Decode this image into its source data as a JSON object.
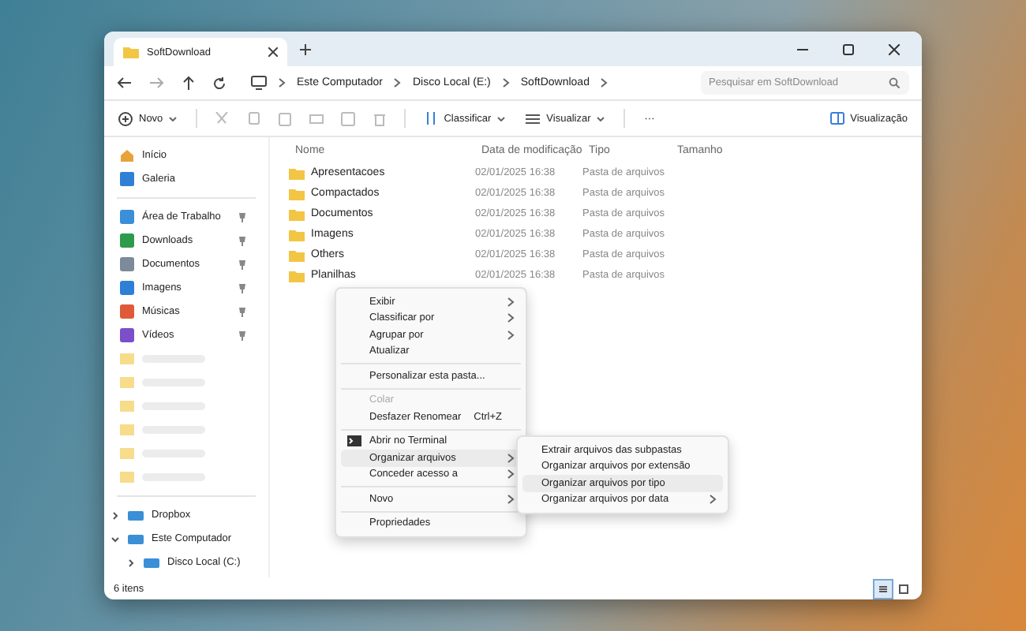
{
  "tabs": [
    {
      "title": "SoftDownload",
      "selected": true
    }
  ],
  "address": {
    "crumbs": [
      "Este Computador",
      "Disco Local (E:)",
      "SoftDownload"
    ],
    "search_placeholder": "Pesquisar em SoftDownload"
  },
  "toolbar": {
    "new": "Novo",
    "sort": "Classificar",
    "view": "Visualizar",
    "more": "···",
    "preview": "Visualização"
  },
  "sidebar": {
    "top": [
      "Início",
      "Galeria"
    ],
    "pinned": [
      {
        "label": "Área de Trabalho",
        "pinned": true
      },
      {
        "label": "Downloads",
        "pinned": true
      },
      {
        "label": "Documentos",
        "pinned": true
      },
      {
        "label": "Imagens",
        "pinned": true
      },
      {
        "label": "Músicas",
        "pinned": true
      },
      {
        "label": "Vídeos",
        "pinned": true
      }
    ],
    "tree": [
      {
        "label": "Dropbox",
        "expanded": false
      },
      {
        "label": "Este Computador",
        "expanded": true,
        "children": [
          {
            "label": "Disco Local (C:)",
            "expanded": false
          }
        ]
      }
    ]
  },
  "table": {
    "columns": [
      "Nome",
      "Data de modificação",
      "Tipo",
      "Tamanho"
    ],
    "rows": [
      {
        "name": "Apresentacoes",
        "date": "02/01/2025 16:38",
        "type": "Pasta de arquivos"
      },
      {
        "name": "Compactados",
        "date": "02/01/2025 16:38",
        "type": "Pasta de arquivos"
      },
      {
        "name": "Documentos",
        "date": "02/01/2025 16:38",
        "type": "Pasta de arquivos"
      },
      {
        "name": "Imagens",
        "date": "02/01/2025 16:38",
        "type": "Pasta de arquivos"
      },
      {
        "name": "Others",
        "date": "02/01/2025 16:38",
        "type": "Pasta de arquivos"
      },
      {
        "name": "Planilhas",
        "date": "02/01/2025 16:38",
        "type": "Pasta de arquivos"
      }
    ]
  },
  "context_menu": {
    "groups": [
      [
        {
          "label": "Exibir",
          "submenu": true,
          "disabled": false,
          "selected": false
        },
        {
          "label": "Classificar por",
          "submenu": true,
          "disabled": false,
          "selected": false
        },
        {
          "label": "Agrupar por",
          "submenu": true,
          "disabled": false,
          "selected": false
        },
        {
          "label": "Atualizar",
          "submenu": false,
          "disabled": false,
          "selected": false
        }
      ],
      [
        {
          "label": "Personalizar esta pasta...",
          "submenu": false,
          "disabled": false,
          "selected": false
        }
      ],
      [
        {
          "label": "Colar",
          "submenu": false,
          "disabled": true,
          "selected": false
        },
        {
          "label": "Desfazer Renomear",
          "shortcut": "Ctrl+Z",
          "submenu": false,
          "disabled": false,
          "selected": false
        }
      ],
      [
        {
          "label": "Abrir no Terminal",
          "submenu": false,
          "disabled": false,
          "selected": false,
          "terminal": true
        },
        {
          "label": "Organizar arquivos",
          "submenu": true,
          "disabled": false,
          "selected": true
        },
        {
          "label": "Conceder acesso a",
          "submenu": true,
          "disabled": false,
          "selected": false
        }
      ],
      [
        {
          "label": "Novo",
          "submenu": true,
          "disabled": false,
          "selected": false
        }
      ],
      [
        {
          "label": "Propriedades",
          "submenu": false,
          "disabled": false,
          "selected": false
        }
      ]
    ]
  },
  "submenu": [
    {
      "label": "Extrair arquivos das subpastas",
      "submenu": false,
      "selected": false
    },
    {
      "label": "Organizar arquivos por extensão",
      "submenu": false,
      "selected": false
    },
    {
      "label": "Organizar arquivos por tipo",
      "submenu": false,
      "selected": true
    },
    {
      "label": "Organizar arquivos por data",
      "submenu": true,
      "selected": false
    }
  ],
  "status_bar": {
    "count": "6 itens",
    "views": [
      {
        "selected": true
      },
      {
        "selected": false
      }
    ]
  }
}
